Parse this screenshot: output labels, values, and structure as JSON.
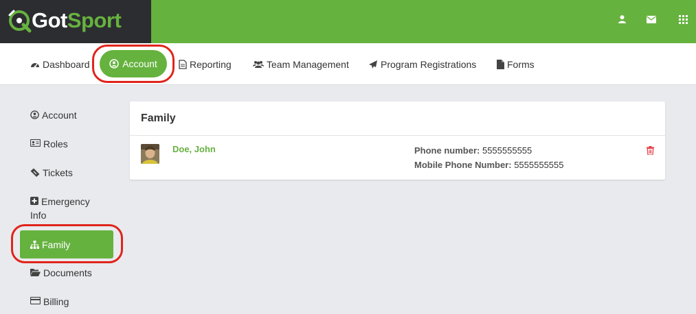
{
  "brand": {
    "name_part1": "Got",
    "name_part2": "Sport"
  },
  "topbar": {
    "icons": [
      "user-icon",
      "envelope-icon",
      "apps-grid-icon"
    ]
  },
  "nav": {
    "dashboard": "Dashboard",
    "account": "Account",
    "reporting": "Reporting",
    "team_management": "Team Management",
    "program_registrations": "Program Registrations",
    "forms": "Forms"
  },
  "sidebar": {
    "account": "Account",
    "roles": "Roles",
    "tickets": "Tickets",
    "emergency_line1": "Emergency",
    "emergency_line2": "Info",
    "family": "Family",
    "documents": "Documents",
    "billing": "Billing"
  },
  "family_card": {
    "title": "Family",
    "member": {
      "name": "Doe, John",
      "phone_label": "Phone number:",
      "phone_value": "5555555555",
      "mobile_label": "Mobile Phone Number:",
      "mobile_value": "5555555555"
    }
  },
  "colors": {
    "brand_green": "#66b23f",
    "brand_dark": "#2c2d30",
    "highlight_red": "#e0241b",
    "delete_red": "#e8434b"
  }
}
